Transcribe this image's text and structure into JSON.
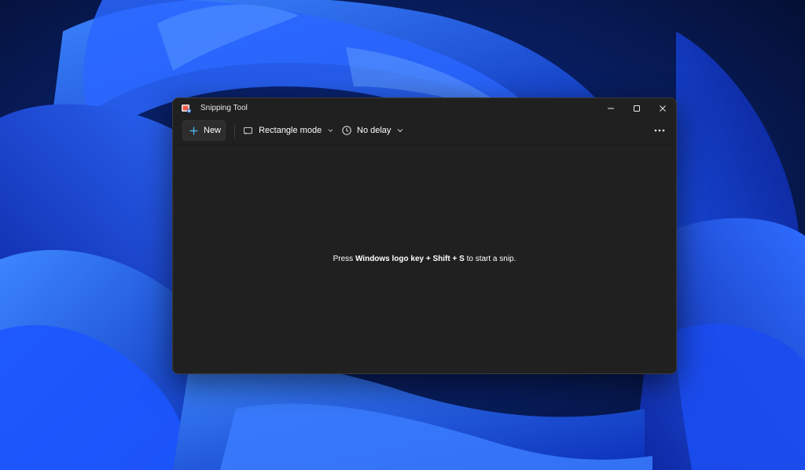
{
  "window": {
    "title": "Snipping Tool",
    "app_icon": "snipping-tool-icon"
  },
  "caption_buttons": {
    "minimize_icon": "minimize-icon",
    "maximize_icon": "maximize-icon",
    "close_icon": "close-icon"
  },
  "toolbar": {
    "new_label": "New",
    "mode_label": "Rectangle mode",
    "mode_icon": "rectangle-mode-icon",
    "delay_label": "No delay",
    "delay_icon": "clock-icon",
    "more_icon": "more-options-icon"
  },
  "hint": {
    "prefix": "Press ",
    "key1": "Windows logo key",
    "plus1": " + ",
    "key2": "Shift",
    "plus2": " + ",
    "key3": "S",
    "suffix": " to start a snip."
  },
  "colors": {
    "window_bg": "#202020",
    "accent": "#4cc2ff",
    "wallpaper_dark": "#06163f",
    "wallpaper_bright": "#1f6bff"
  }
}
